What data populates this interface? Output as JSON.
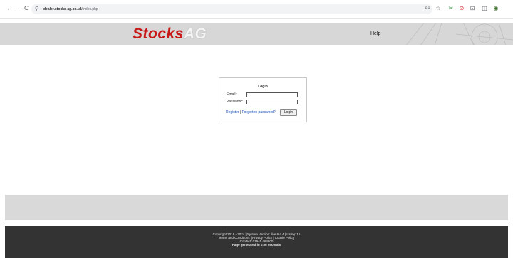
{
  "browser": {
    "back_icon": "←",
    "forward_icon": "→",
    "reload_icon": "C",
    "site_info_icon": "⚲",
    "url_domain": "dealer.stocks-ag.co.uk",
    "url_path": "/index.php",
    "translate_icon": "Aa",
    "bookmark_icon": "☆",
    "ext1_icon": "✂",
    "ext2_icon": "⊘",
    "puzzle_icon": "⊡",
    "split_icon": "◫",
    "profile_icon": "◉"
  },
  "header": {
    "logo_part1": "Stocks",
    "logo_part2": "AG",
    "help_label": "Help",
    "background_color": "#d7d7d7",
    "logo_color": "#c81919"
  },
  "login": {
    "title": "Login",
    "email_label": "Email:",
    "email_value": "",
    "password_label": "Password:",
    "password_value": "",
    "register_label": "Register",
    "separator": "|",
    "forgotten_label": "Forgotten password?",
    "login_button_label": "Login"
  },
  "footer": {
    "line1": "Copyright 2018 - 2024 | System Version: live 6.4.4 | Using: 15",
    "line2": "Terms and Conditions | Privacy Policy | Cookie Policy",
    "line3": "Contact: 01945 464800",
    "line4": "Page generated in 0.06 seconds",
    "background_color": "#333333"
  }
}
